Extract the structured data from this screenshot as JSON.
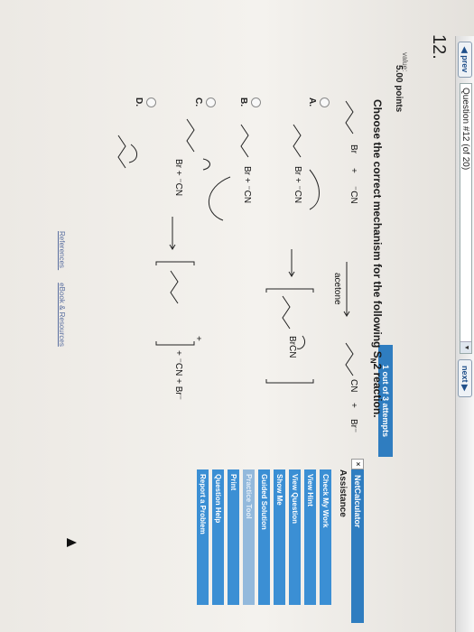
{
  "nav": {
    "prev": "◀ prev",
    "question": "Question #12 (of 20)",
    "next": "next ▶"
  },
  "question": {
    "number": "12.",
    "value_label": "value:",
    "points": "5.00 points"
  },
  "attempts": "1 out of 3 attempts",
  "prompt": {
    "prefix": "Choose the correct mechanism for the following S",
    "sub": "N",
    "suffix": "2 reaction."
  },
  "reaction": {
    "reactant1": "Br",
    "plus1": "+",
    "reactant2": "⁻CN",
    "solvent": "acetone",
    "product": "CN",
    "plus2": "+",
    "product2": "Br⁻"
  },
  "options": [
    {
      "label": "A.",
      "expression": "Br + ⁻CN",
      "intermediate": "BrCN"
    },
    {
      "label": "B.",
      "expression": "Br + ⁻CN"
    },
    {
      "label": "C.",
      "expression": "Br + ⁻CN",
      "intermediate_charge": "+",
      "products": "+ ⁻CN + Br⁻"
    },
    {
      "label": "D."
    }
  ],
  "sidebar": {
    "netcalc": "NetCalculator",
    "assistance": "Assistance",
    "buttons": [
      "Check My Work",
      "View Hint",
      "View Question",
      "Show Me",
      "Guided Solution",
      "Practice Tool",
      "Print",
      "Question Help",
      "Report a Problem"
    ]
  },
  "footer": {
    "references": "References",
    "ebook": "eBook & Resources"
  },
  "colors": {
    "accent": "#2f7dc0",
    "button": "#3b8fd4",
    "link": "#5a6fa0"
  }
}
